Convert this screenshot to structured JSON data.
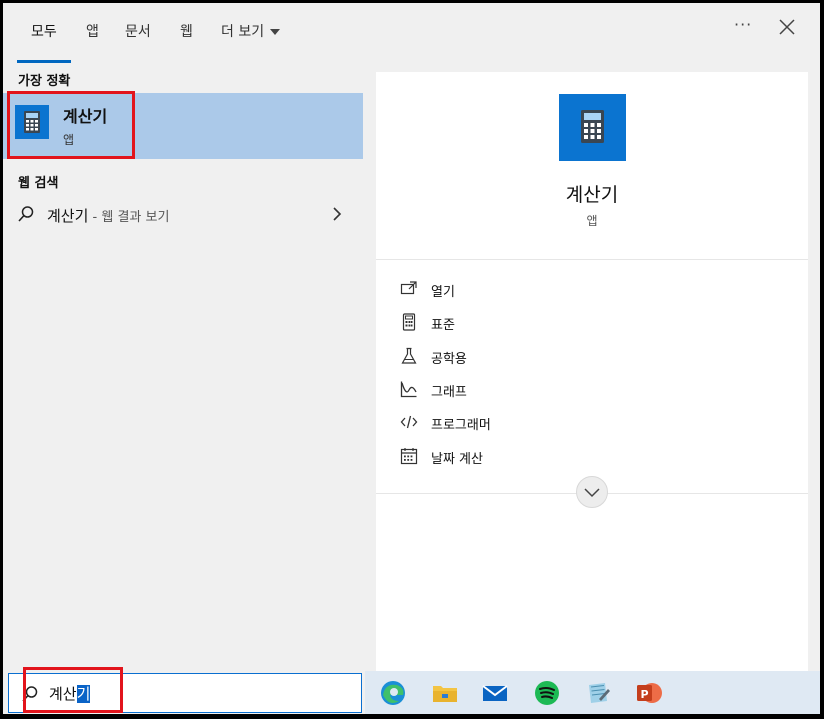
{
  "tabs": [
    {
      "label": "모두",
      "active": true
    },
    {
      "label": "앱"
    },
    {
      "label": "문서"
    },
    {
      "label": "웹"
    },
    {
      "label": "더 보기"
    }
  ],
  "window_controls": {
    "more": "···"
  },
  "best_match": {
    "section_label": "가장 정확",
    "name": "계산기",
    "type": "앱"
  },
  "web_search": {
    "section_label": "웹 검색",
    "query": "계산기",
    "suffix": " - 웹 결과 보기"
  },
  "detail": {
    "title": "계산기",
    "type": "앱",
    "actions": [
      {
        "label": "열기",
        "icon": "open-icon"
      },
      {
        "label": "표준",
        "icon": "calculator-icon"
      },
      {
        "label": "공학용",
        "icon": "flask-icon"
      },
      {
        "label": "그래프",
        "icon": "graph-icon"
      },
      {
        "label": "프로그래머",
        "icon": "code-icon"
      },
      {
        "label": "날짜 계산",
        "icon": "calendar-icon"
      }
    ]
  },
  "search_box": {
    "text_before": "계산",
    "text_selected": "기"
  },
  "taskbar": {
    "apps": [
      "edge-icon",
      "file-explorer-icon",
      "mail-icon",
      "spotify-icon",
      "notepad-icon",
      "powerpoint-icon"
    ]
  },
  "colors": {
    "accent": "#0067c0",
    "selection": "#abc9e9",
    "highlight_box": "#e2141c",
    "app_tile": "#0b74d0"
  }
}
